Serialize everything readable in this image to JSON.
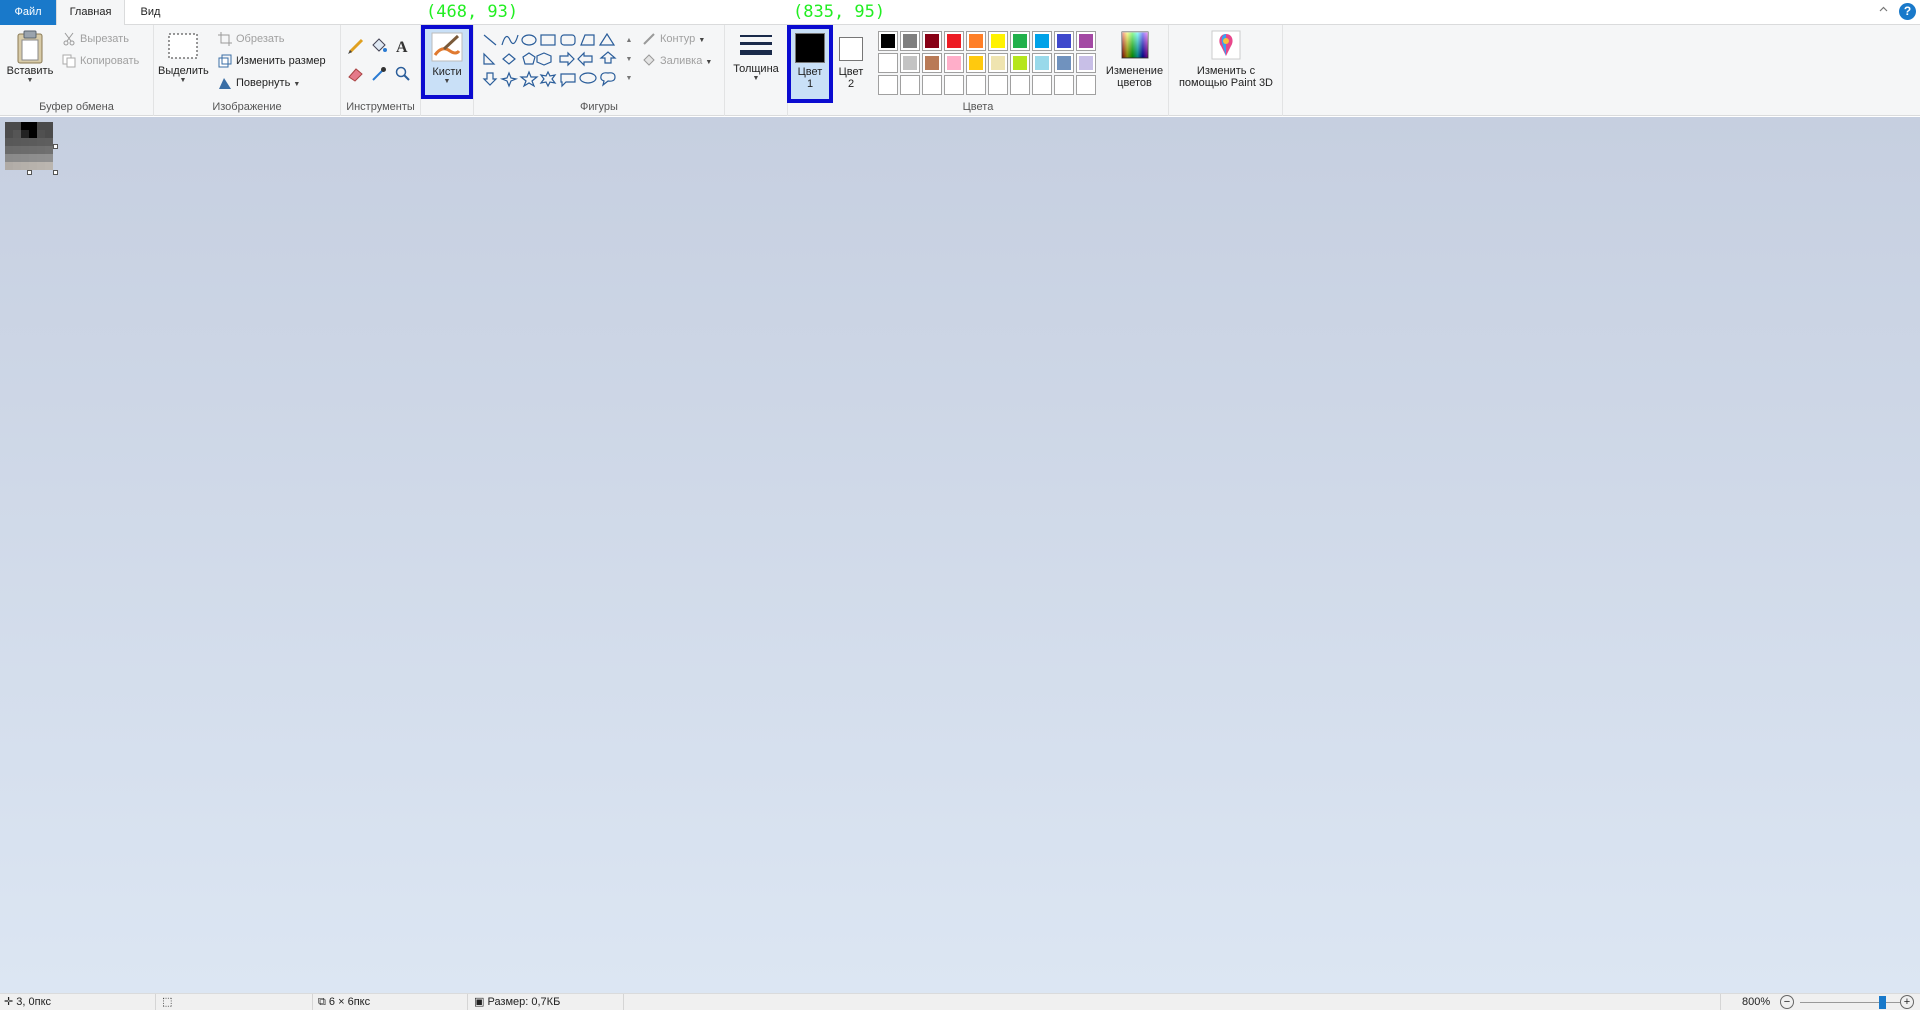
{
  "tabs": {
    "file": "Файл",
    "home": "Главная",
    "view": "Вид"
  },
  "clipboard": {
    "paste": "Вставить",
    "cut": "Вырезать",
    "copy": "Копировать",
    "label": "Буфер обмена"
  },
  "image_group": {
    "select": "Выделить",
    "crop": "Обрезать",
    "resize": "Изменить размер",
    "rotate": "Повернуть",
    "label": "Изображение"
  },
  "tools": {
    "label": "Инструменты"
  },
  "brushes": {
    "label": "Кисти"
  },
  "shapes": {
    "outline": "Контур",
    "fill": "Заливка",
    "label": "Фигуры"
  },
  "thickness": {
    "label": "Толщина"
  },
  "colors": {
    "color1_line1": "Цвет",
    "color1_line2": "1",
    "color2_line1": "Цвет",
    "color2_line2": "2",
    "edit_colors_line1": "Изменение",
    "edit_colors_line2": "цветов",
    "label": "Цвета",
    "color1_value": "#000000",
    "color2_value": "#ffffff",
    "palette_row1": [
      "#000000",
      "#7f7f7f",
      "#880015",
      "#ed1c24",
      "#ff7f27",
      "#fff200",
      "#22b14c",
      "#00a2e8",
      "#3f48cc",
      "#a349a4"
    ],
    "palette_row2": [
      "#ffffff",
      "#c3c3c3",
      "#b97a57",
      "#ffaec9",
      "#ffc90e",
      "#efe4b0",
      "#b5e61d",
      "#99d9ea",
      "#7092be",
      "#c8bfe7"
    ],
    "palette_row3": [
      "#ffffff",
      "#ffffff",
      "#ffffff",
      "#ffffff",
      "#ffffff",
      "#ffffff",
      "#ffffff",
      "#ffffff",
      "#ffffff",
      "#ffffff"
    ]
  },
  "paint3d": {
    "line1": "Изменить с",
    "line2": "помощью Paint 3D"
  },
  "annotations": {
    "a1": "(468, 93)",
    "a2": "(835, 95)"
  },
  "image_pixels": [
    "#4a4a4a",
    "#4a4a4a",
    "#000000",
    "#000000",
    "#4a4a4a",
    "#4a4a4a",
    "#4c4c4c",
    "#555555",
    "#222222",
    "#000000",
    "#505050",
    "#4b4b4b",
    "#585858",
    "#595959",
    "#5a5a5a",
    "#5b5b5b",
    "#5d5d5d",
    "#5e5e5e",
    "#6a6a6a",
    "#6b6b6b",
    "#6c6c6c",
    "#6d6d6d",
    "#6e6e6e",
    "#707070",
    "#8a8a8a",
    "#8b8b8b",
    "#8c8c8c",
    "#8e8e8e",
    "#8f8f8f",
    "#909090",
    "#b0aba6",
    "#b3aea9",
    "#b5b0aa",
    "#b7b2ac",
    "#b9b4ae",
    "#bbb6b0"
  ],
  "status": {
    "position": "3, 0пкс",
    "dimensions": "6 × 6пкс",
    "size": "Размер: 0,7КБ",
    "zoom": "800%"
  }
}
